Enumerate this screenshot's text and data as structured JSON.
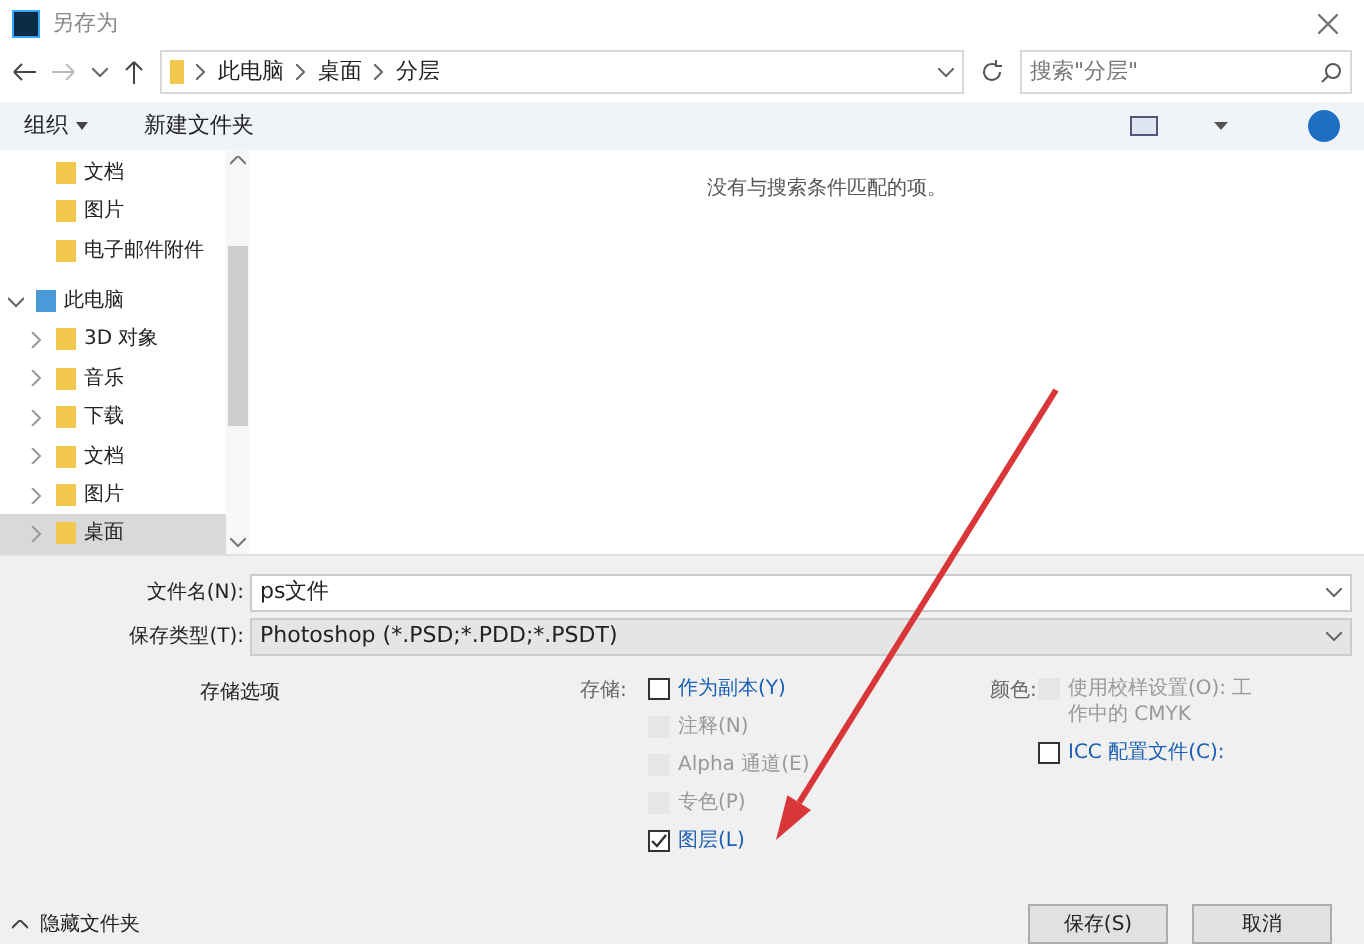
{
  "window": {
    "title": "另存为"
  },
  "address": {
    "path": [
      "此电脑",
      "桌面",
      "分层"
    ],
    "search_placeholder": "搜索\"分层\""
  },
  "toolbar": {
    "organize": "组织",
    "new_folder": "新建文件夹"
  },
  "sidebar": {
    "quick_items": [
      {
        "label": "文档",
        "selected": false
      },
      {
        "label": "图片",
        "selected": false
      },
      {
        "label": "电子邮件附件",
        "selected": false
      }
    ],
    "tree": {
      "label": "此电脑",
      "expanded": true,
      "selected": false,
      "children": [
        {
          "label": "3D 对象",
          "expanded": false,
          "selected": false
        },
        {
          "label": "音乐",
          "expanded": false,
          "selected": false
        },
        {
          "label": "下载",
          "expanded": false,
          "selected": false
        },
        {
          "label": "文档",
          "expanded": false,
          "selected": false
        },
        {
          "label": "图片",
          "expanded": false,
          "selected": false
        },
        {
          "label": "桌面",
          "expanded": false,
          "selected": true
        }
      ]
    }
  },
  "empty_message": "没有与搜索条件匹配的项。",
  "filename": {
    "label": "文件名(N):",
    "value": "ps文件"
  },
  "filetype": {
    "label": "保存类型(T):",
    "value": "Photoshop (*.PSD;*.PDD;*.PSDT)"
  },
  "options": {
    "heading": "存储选项",
    "save_label": "存储:",
    "save_items": [
      {
        "label": "作为副本(Y)",
        "checked": false,
        "disabled": false
      },
      {
        "label": "注释(N)",
        "checked": false,
        "disabled": true
      },
      {
        "label": "Alpha 通道(E)",
        "checked": false,
        "disabled": true
      },
      {
        "label": "专色(P)",
        "checked": false,
        "disabled": true
      },
      {
        "label": "图层(L)",
        "checked": true,
        "disabled": false
      }
    ],
    "color_label": "颜色:",
    "color_items": [
      {
        "label": "使用校样设置(O): 工作中的 CMYK",
        "checked": false,
        "disabled": true
      },
      {
        "label": "ICC 配置文件(C):",
        "checked": false,
        "disabled": false
      }
    ]
  },
  "buttons": [
    "保存(S)",
    "取消"
  ],
  "hide_folders": "隐藏文件夹"
}
